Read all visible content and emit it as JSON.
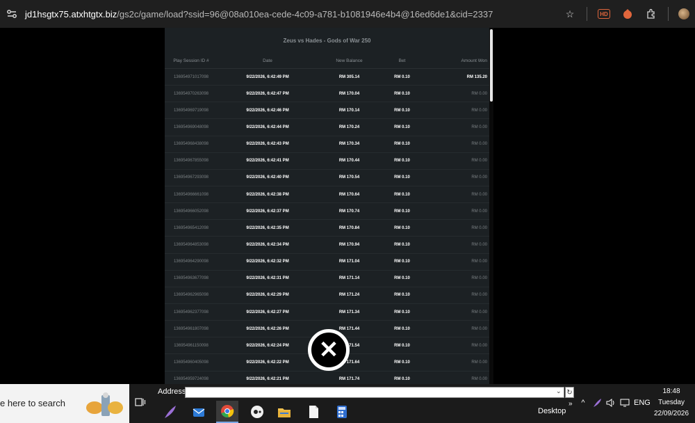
{
  "browser": {
    "url_host": "jd1hsgtx75.atxhtgtx.biz",
    "url_path": "/gs2c/game/load?ssid=96@08a010ea-cede-4c09-a781-b1081946e4b4@16ed6de1&cid=2337",
    "icons": [
      "site-info-icon",
      "star-icon",
      "hd-icon",
      "extension-icon",
      "puzzle-icon",
      "profile-avatar"
    ]
  },
  "history": {
    "title": "Zeus vs Hades - Gods of War 250",
    "columns": [
      "Play Session ID #",
      "Date",
      "New Balance",
      "Bet",
      "Amount Won"
    ],
    "rows": [
      [
        "136954971017098",
        "9/22/2026, 6:42:49 PM",
        "RM 305.14",
        "RM 0.10",
        "RM 135.20"
      ],
      [
        "136954970263098",
        "9/22/2026, 6:42:47 PM",
        "RM 170.04",
        "RM 0.10",
        "RM 0.00"
      ],
      [
        "136954969719098",
        "9/22/2026, 6:42:46 PM",
        "RM 170.14",
        "RM 0.10",
        "RM 0.00"
      ],
      [
        "136954969048098",
        "9/22/2026, 6:42:44 PM",
        "RM 170.24",
        "RM 0.10",
        "RM 0.00"
      ],
      [
        "136954968438098",
        "9/22/2026, 6:42:43 PM",
        "RM 170.34",
        "RM 0.10",
        "RM 0.00"
      ],
      [
        "136954967855098",
        "9/22/2026, 6:42:41 PM",
        "RM 170.44",
        "RM 0.10",
        "RM 0.00"
      ],
      [
        "136954967293098",
        "9/22/2026, 6:42:40 PM",
        "RM 170.54",
        "RM 0.10",
        "RM 0.00"
      ],
      [
        "136954966661098",
        "9/22/2026, 6:42:38 PM",
        "RM 170.64",
        "RM 0.10",
        "RM 0.00"
      ],
      [
        "136954966052098",
        "9/22/2026, 6:42:37 PM",
        "RM 170.74",
        "RM 0.10",
        "RM 0.00"
      ],
      [
        "136954965412098",
        "9/22/2026, 6:42:35 PM",
        "RM 170.84",
        "RM 0.10",
        "RM 0.00"
      ],
      [
        "136954964853098",
        "9/22/2026, 6:42:34 PM",
        "RM 170.94",
        "RM 0.10",
        "RM 0.00"
      ],
      [
        "136954964290098",
        "9/22/2026, 6:42:32 PM",
        "RM 171.04",
        "RM 0.10",
        "RM 0.00"
      ],
      [
        "136954963677098",
        "9/22/2026, 6:42:31 PM",
        "RM 171.14",
        "RM 0.10",
        "RM 0.00"
      ],
      [
        "136954962965098",
        "9/22/2026, 6:42:29 PM",
        "RM 171.24",
        "RM 0.10",
        "RM 0.00"
      ],
      [
        "136954962377098",
        "9/22/2026, 6:42:27 PM",
        "RM 171.34",
        "RM 0.10",
        "RM 0.00"
      ],
      [
        "136954961807098",
        "9/22/2026, 6:42:26 PM",
        "RM 171.44",
        "RM 0.10",
        "RM 0.00"
      ],
      [
        "136954961150098",
        "9/22/2026, 6:42:24 PM",
        "RM 171.54",
        "RM 0.10",
        "RM 0.00"
      ],
      [
        "136954960405098",
        "9/22/2026, 6:42:22 PM",
        "RM 171.64",
        "RM 0.10",
        "RM 0.00"
      ],
      [
        "136954959724098",
        "9/22/2026, 6:42:21 PM",
        "RM 171.74",
        "RM 0.10",
        "RM 0.00"
      ]
    ],
    "close_icon": "close-circle-icon"
  },
  "taskbar": {
    "search_placeholder": "e here to search",
    "address_label": "Address",
    "address_value": "",
    "desktop_label": "Desktop",
    "overflow_label": "»",
    "language": "ENG",
    "time": "18:48",
    "day": "Tuesday",
    "date": "22/09/2026",
    "apps": [
      "feather-app-icon",
      "mail-app-icon",
      "chrome-app-icon",
      "media-app-icon",
      "file-explorer-icon",
      "document-app-icon",
      "calculator-app-icon"
    ],
    "tray_icons": [
      "chevron-up-icon",
      "feather-tray-icon",
      "volume-icon",
      "display-icon"
    ]
  },
  "colors": {
    "panel_bg": "#1c2124",
    "page_bg": "#000000",
    "taskbar_bg": "#1b1b1b",
    "muted_text": "#7b8184"
  }
}
